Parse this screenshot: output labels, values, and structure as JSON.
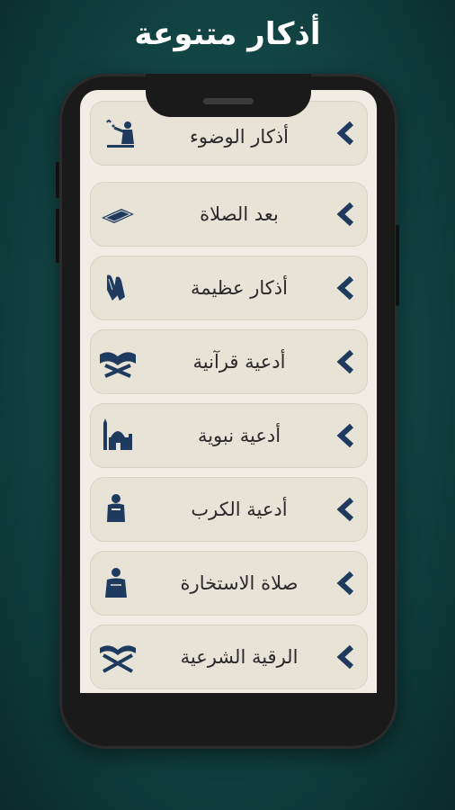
{
  "promo": {
    "title": "أذكار متنوعة"
  },
  "menu": {
    "items": [
      {
        "label": "أذكار الوضوء",
        "icon": "wudu-icon"
      },
      {
        "label": "بعد الصلاة",
        "icon": "prayer-mat-icon"
      },
      {
        "label": "أذكار عظيمة",
        "icon": "praying-hands-icon"
      },
      {
        "label": "أدعية قرآنية",
        "icon": "quran-stand-icon"
      },
      {
        "label": "أدعية نبوية",
        "icon": "mosque-icon"
      },
      {
        "label": "أدعية الكرب",
        "icon": "praying-person-icon"
      },
      {
        "label": "صلاة الاستخارة",
        "icon": "kneeling-person-icon"
      },
      {
        "label": "الرقية الشرعية",
        "icon": "open-quran-icon"
      }
    ]
  },
  "colors": {
    "accent": "#1e3a5f",
    "card": "#e8e3d7",
    "screen": "#f1ede4"
  }
}
